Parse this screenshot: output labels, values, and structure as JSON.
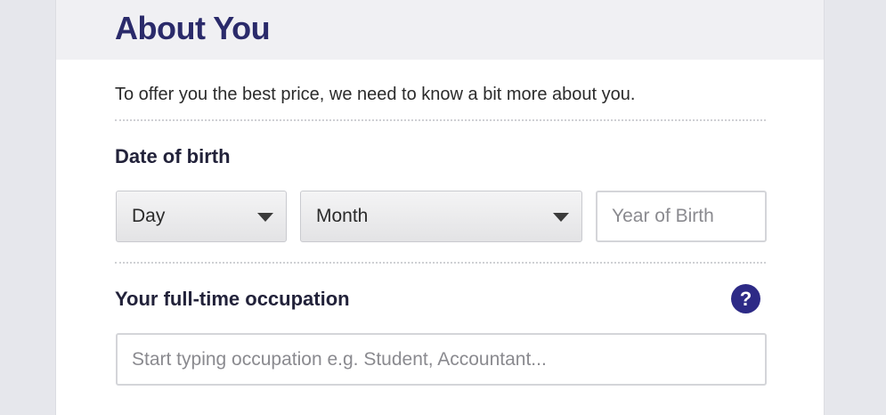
{
  "header": {
    "title": "About You"
  },
  "intro": {
    "text": "To offer you the best price, we need to know a bit more about you."
  },
  "date_of_birth": {
    "label": "Date of birth",
    "day_select": {
      "selected": "Day"
    },
    "month_select": {
      "selected": "Month"
    },
    "year_input": {
      "value": "",
      "placeholder": "Year of Birth"
    }
  },
  "occupation": {
    "label": "Your full-time occupation",
    "help_icon": "question-mark-icon",
    "help_glyph": "?",
    "input": {
      "value": "",
      "placeholder": "Start typing occupation e.g. Student, Accountant..."
    }
  },
  "colors": {
    "title": "#2a2a6a",
    "accent": "#2d2a86",
    "page_background": "#e6e7ec"
  }
}
